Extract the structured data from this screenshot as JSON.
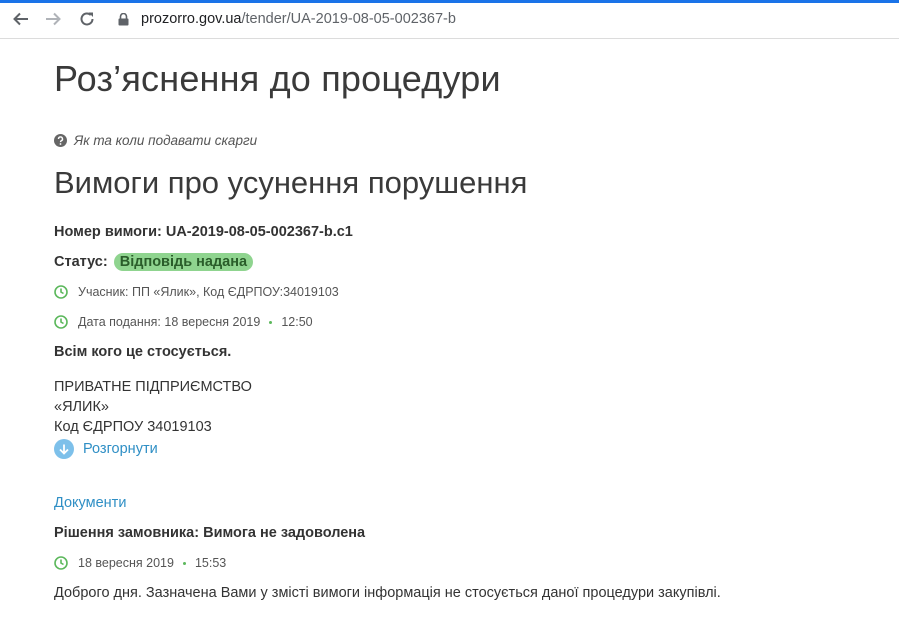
{
  "browser": {
    "url_host": "prozorro.gov.ua",
    "url_path": "/tender/UA-2019-08-05-002367-b"
  },
  "page": {
    "title": "Роз’яснення до процедури",
    "help_link": "Як та коли подавати скарги",
    "section_title": "Вимоги про усунення порушення",
    "claim_number_label": "Номер вимоги:",
    "claim_number": "UA-2019-08-05-002367-b.c1",
    "status_label": "Статус:",
    "status_value": "Відповідь надана",
    "participant": "Учасник: ПП «Ялик», Код ЄДРПОУ:34019103",
    "submission_date": "Дата подання: 18 вересня 2019",
    "submission_time": "12:50",
    "greeting": "Всім кого це стосується.",
    "body_lines": [
      "ПРИВАТНЕ ПІДПРИЄМСТВО",
      "«ЯЛИК»",
      "Код ЄДРПОУ 34019103"
    ],
    "expand_label": "Розгорнути",
    "documents_link": "Документи",
    "decision": "Рішення замовника: Вимога не задоволена",
    "decision_date": "18 вересня 2019",
    "decision_time": "15:53",
    "decision_text": "Доброго дня. Зазначена Вами у змісті вимоги інформація не стосується даної процедури закупівлі."
  },
  "colors": {
    "accent": "#1a73e8",
    "link": "#2f8fc5",
    "status_badge": "#8fd48f",
    "clock_icon": "#5cb85c"
  }
}
